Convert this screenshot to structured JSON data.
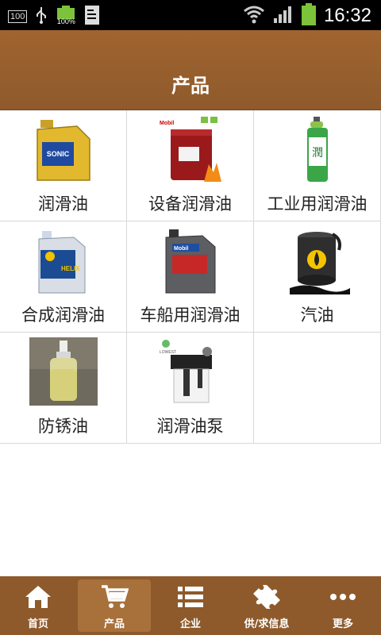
{
  "status": {
    "badge": "100",
    "battery_pct": "100%",
    "time": "16:32"
  },
  "header": {
    "title": "产品"
  },
  "products": [
    {
      "label": "润滑油",
      "icon": "motor-oil-bottle-icon"
    },
    {
      "label": "设备润滑油",
      "icon": "oil-drum-icon"
    },
    {
      "label": "工业用润滑油",
      "icon": "spray-can-icon"
    },
    {
      "label": "合成润滑油",
      "icon": "oil-jug-blue-icon"
    },
    {
      "label": "车船用润滑油",
      "icon": "oil-jug-gray-icon"
    },
    {
      "label": "汽油",
      "icon": "fuel-barrel-icon"
    },
    {
      "label": "防锈油",
      "icon": "dropper-bottle-icon"
    },
    {
      "label": "润滑油泵",
      "icon": "lubrication-pump-icon"
    }
  ],
  "bottom_nav": [
    {
      "label": "首页",
      "icon": "home-icon",
      "active": false
    },
    {
      "label": "产品",
      "icon": "cart-icon",
      "active": true
    },
    {
      "label": "企业",
      "icon": "list-icon",
      "active": false
    },
    {
      "label": "供/求信息",
      "icon": "puzzle-icon",
      "active": false
    },
    {
      "label": "更多",
      "icon": "more-icon",
      "active": false
    }
  ],
  "colors": {
    "header": "#9b6230",
    "nav": "#8e5a2b",
    "nav_active": "#a8703b"
  }
}
